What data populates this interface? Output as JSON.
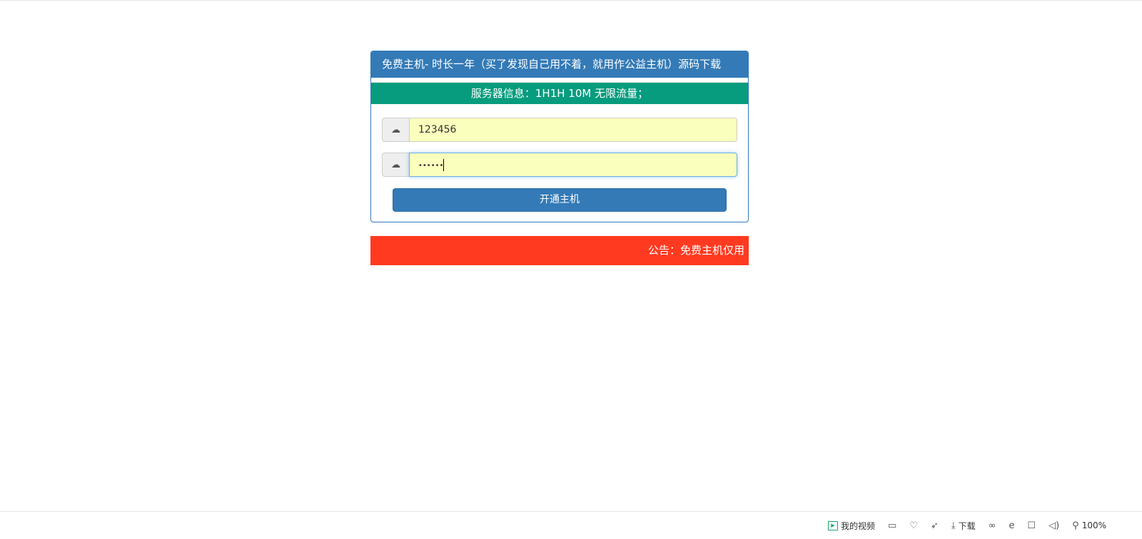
{
  "panel": {
    "title": "免费主机- 时长一年（买了发现自己用不着，就用作公益主机）源码下载",
    "server_info": "服务器信息：1H1H 10M 无限流量；",
    "username": {
      "value": "123456",
      "icon": "cloud-icon"
    },
    "password": {
      "value": "••••••",
      "icon": "cloud-icon"
    },
    "submit_label": "开通主机"
  },
  "notice": {
    "text": "公告：免费主机仅用"
  },
  "statusbar": {
    "video_label": "我的视频",
    "download_label": "下载",
    "zoom_label": "100%"
  },
  "colors": {
    "primary": "#337ab7",
    "info": "#069c7d",
    "notice": "#ff3a20",
    "autofill": "#faffbd"
  }
}
